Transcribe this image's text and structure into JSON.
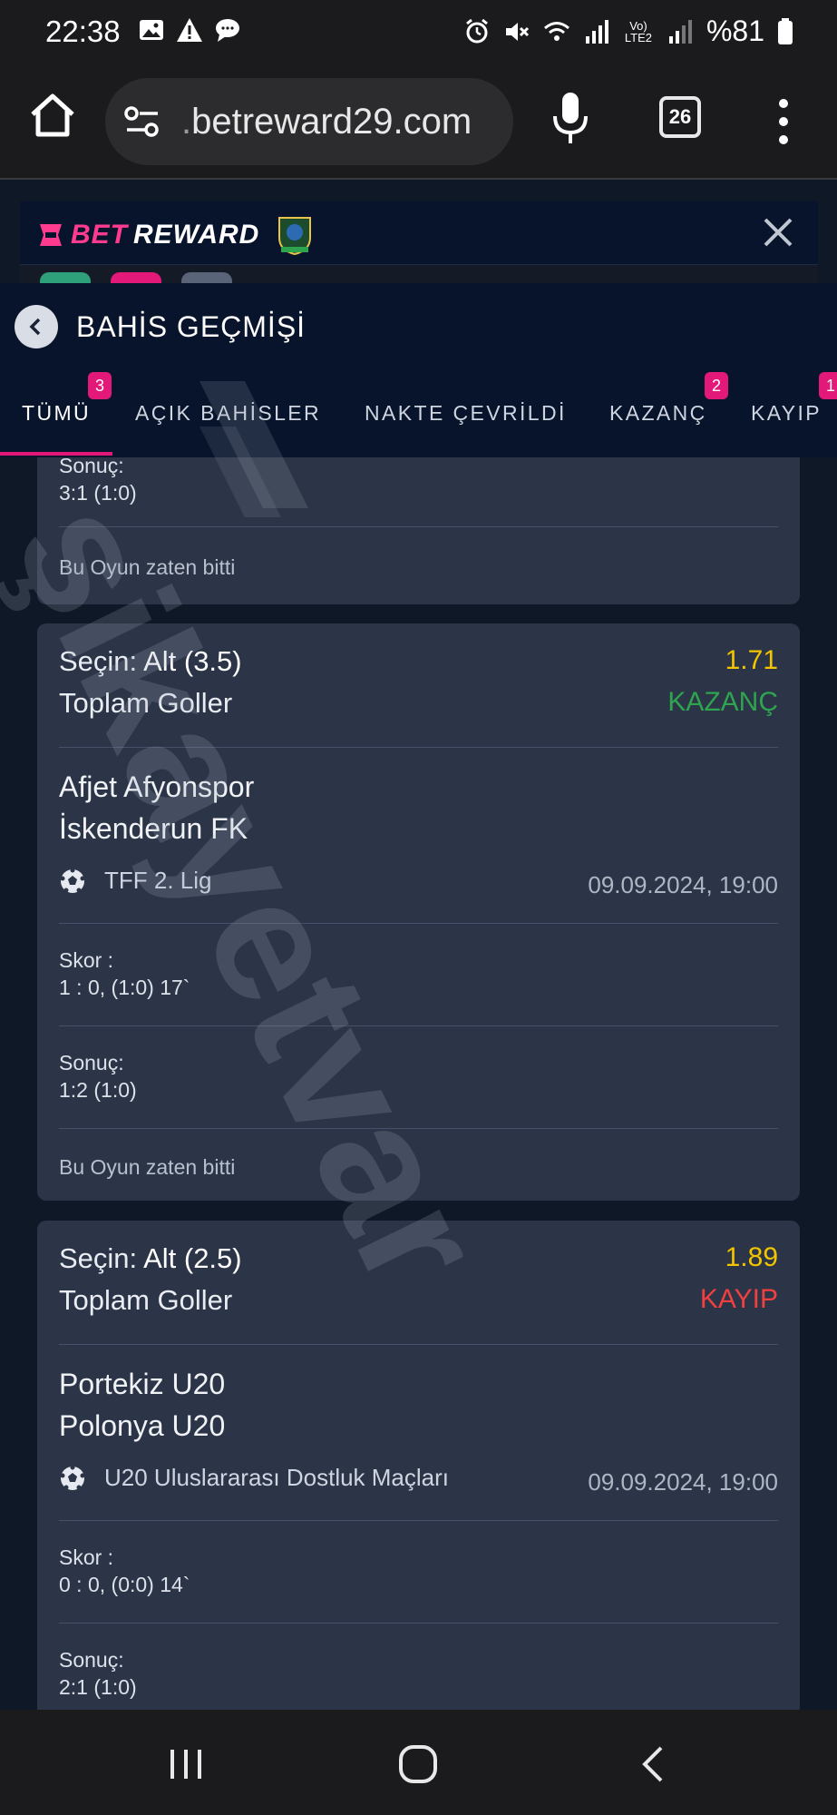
{
  "status": {
    "time": "22:38",
    "battery": "%81",
    "signal_label": "Vo) LTE2"
  },
  "browser": {
    "url_prefix": ".",
    "url_main": "betreward29.com",
    "tab_count": "26"
  },
  "site": {
    "logo_bet": "BET",
    "logo_reward": "REWARD"
  },
  "page": {
    "title": "BAHİS GEÇMİŞİ"
  },
  "tabs": [
    {
      "label": "TÜMÜ",
      "count": "3"
    },
    {
      "label": "AÇIK BAHİSLER"
    },
    {
      "label": "NAKTE ÇEVRİLDİ"
    },
    {
      "label": "KAZANÇ",
      "count": "2"
    },
    {
      "label": "KAYIP",
      "count": "1"
    }
  ],
  "watermark": "şikayetvar",
  "bets": [
    {
      "result_label": "Sonuç:",
      "result_value": "3:1 (1:0)",
      "footer": "Bu Oyun zaten bitti"
    },
    {
      "pick_prefix": "Seçin:",
      "pick_value": "Alt (3.5)",
      "market": "Toplam Goller",
      "odds": "1.71",
      "status": "KAZANÇ",
      "home": "Afjet Afyonspor",
      "away": "İskenderun FK",
      "league": "TFF 2. Lig",
      "date": "09.09.2024, 19:00",
      "score_label": "Skor :",
      "score_value": "1 : 0, (1:0) 17`",
      "result_label": "Sonuç:",
      "result_value": "1:2 (1:0)",
      "footer": "Bu Oyun zaten bitti"
    },
    {
      "pick_prefix": "Seçin:",
      "pick_value": "Alt (2.5)",
      "market": "Toplam Goller",
      "odds": "1.89",
      "status": "KAYIP",
      "home": "Portekiz U20",
      "away": "Polonya U20",
      "league": "U20 Uluslararası Dostluk Maçları",
      "date": "09.09.2024, 19:00",
      "score_label": "Skor :",
      "score_value": "0 : 0, (0:0) 14`",
      "result_label": "Sonuç:",
      "result_value": "2:1 (1:0)"
    }
  ],
  "colors": {
    "accent": "#e3197a",
    "odds": "#f2c500",
    "win": "#2ea44f",
    "lose": "#f04040"
  }
}
